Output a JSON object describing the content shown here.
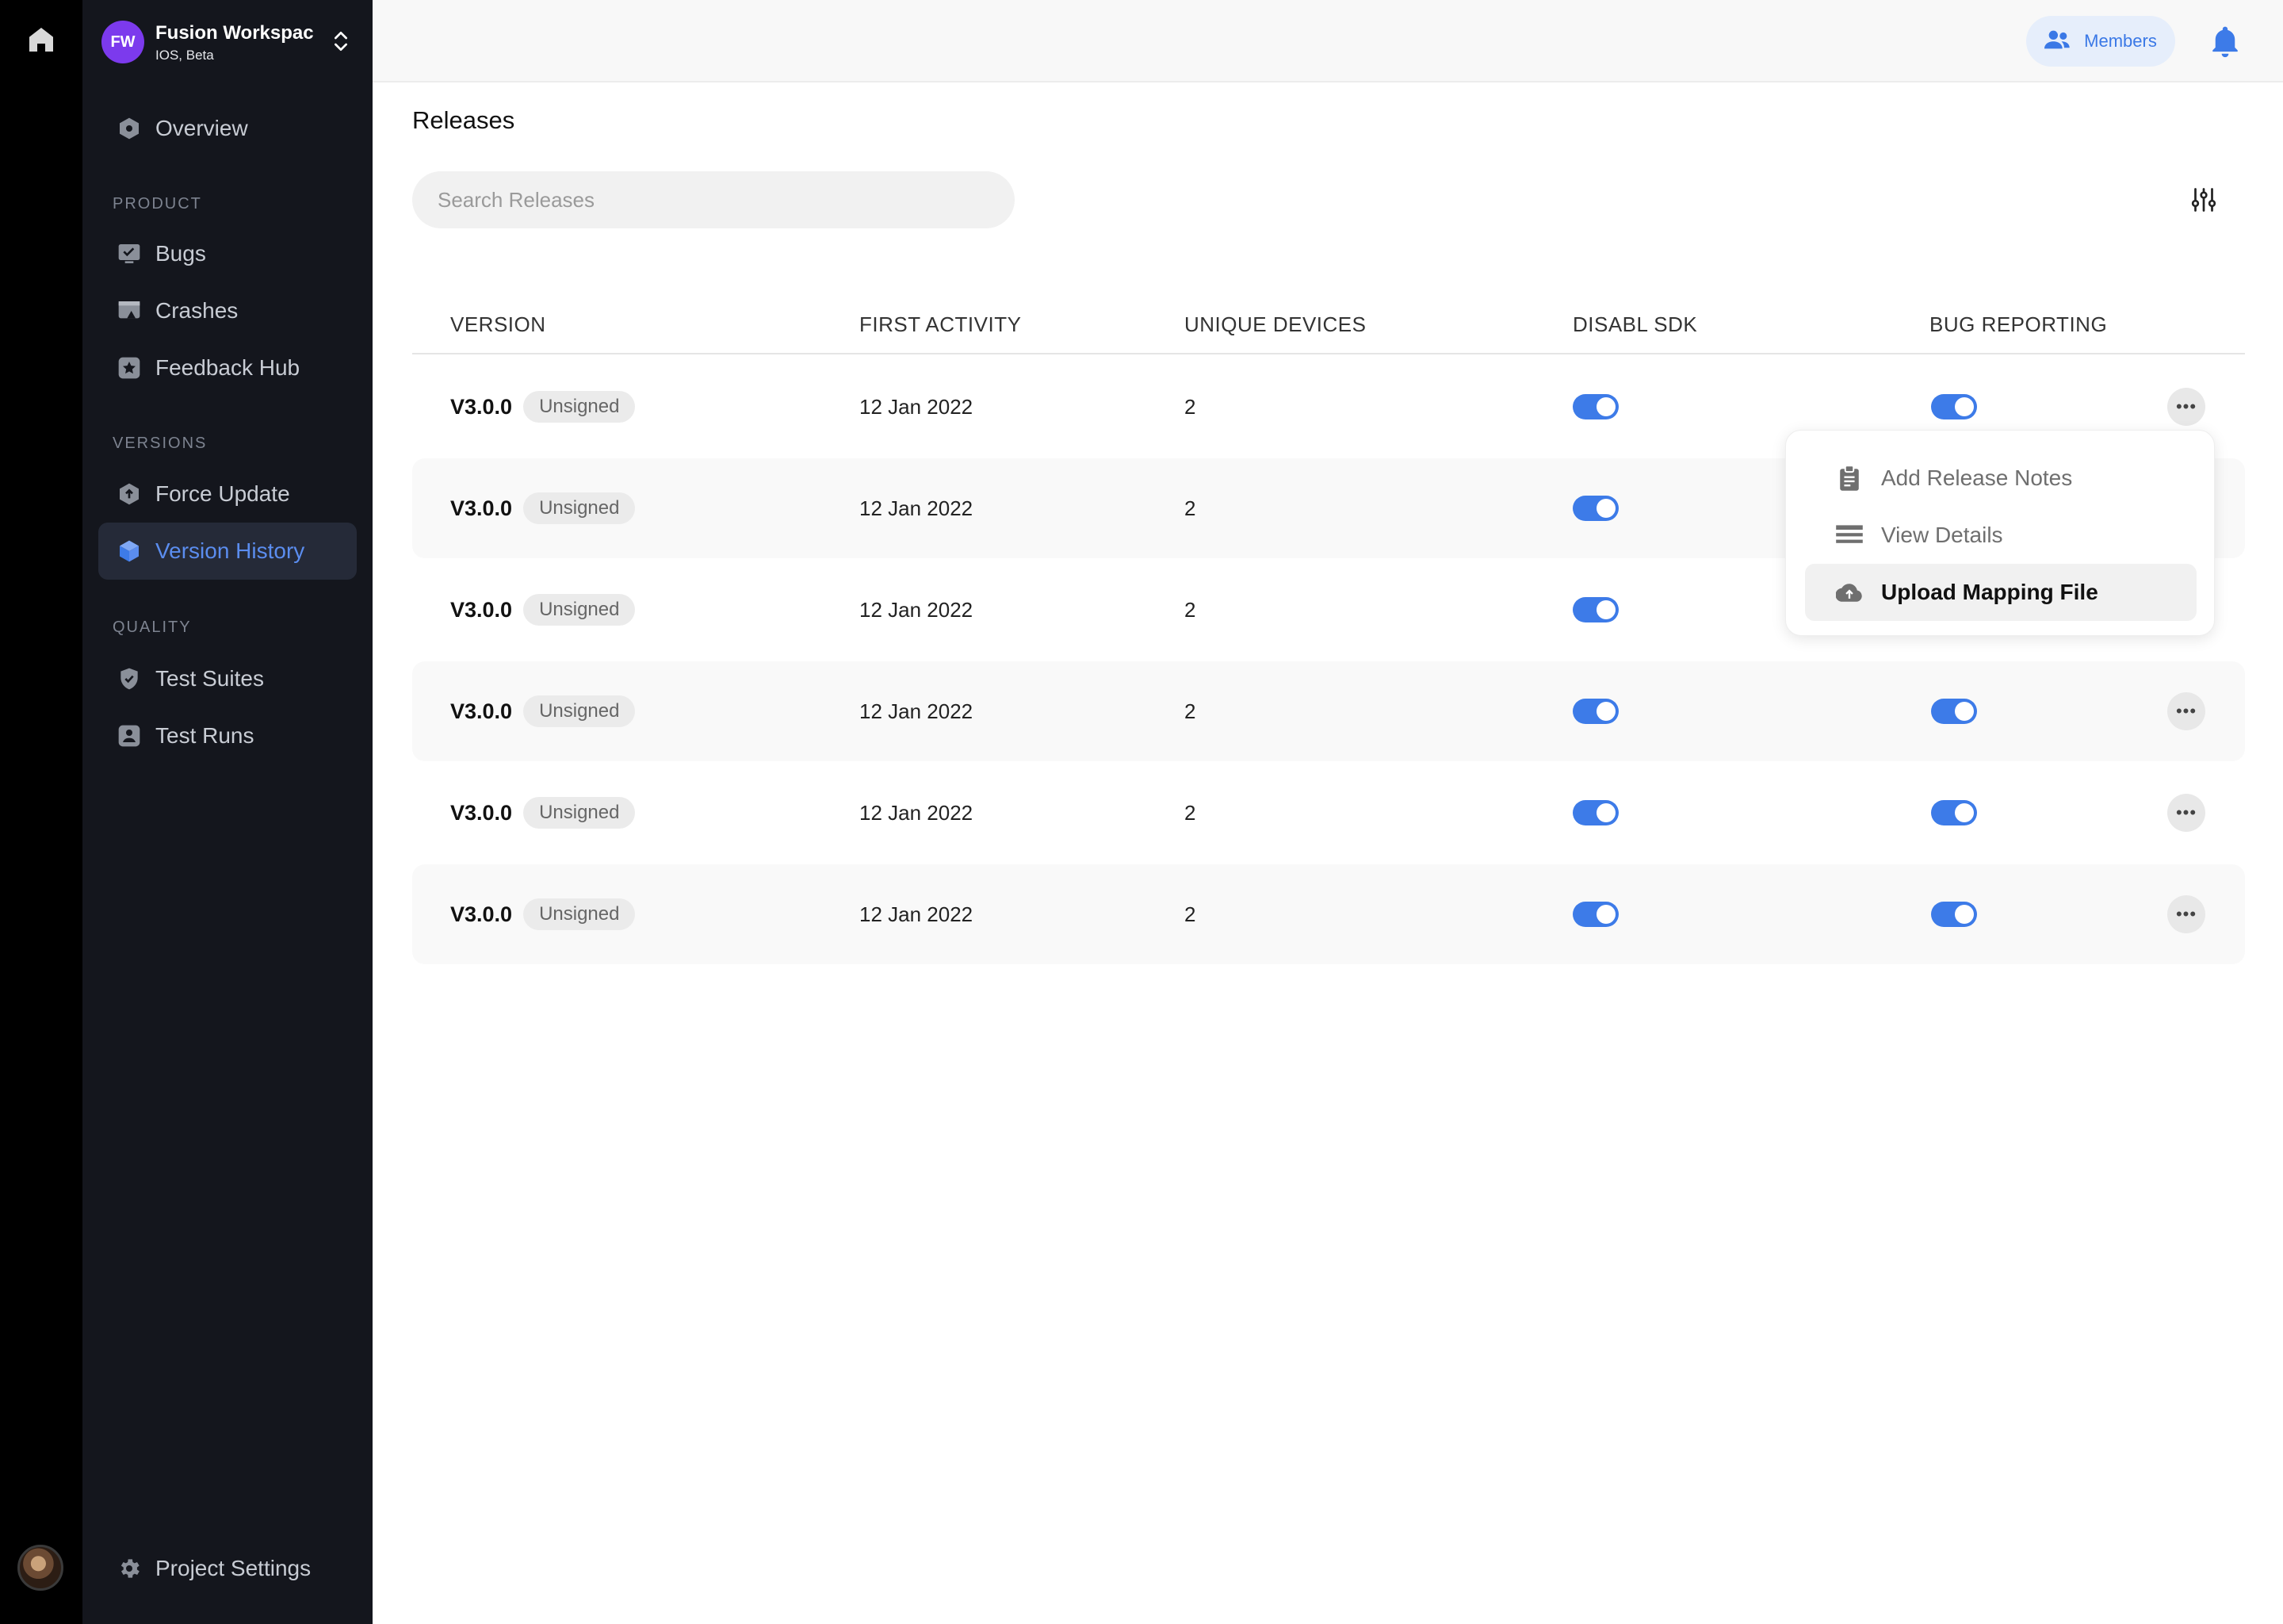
{
  "workspace": {
    "initials": "FW",
    "name": "Fusion Workspace",
    "subtitle": "IOS, Beta"
  },
  "sidebar": {
    "overview": "Overview",
    "sections": [
      {
        "label": "PRODUCT",
        "items": [
          "Bugs",
          "Crashes",
          "Feedback Hub"
        ]
      },
      {
        "label": "VERSIONS",
        "items": [
          "Force Update",
          "Version History"
        ]
      },
      {
        "label": "QUALITY",
        "items": [
          "Test Suites",
          "Test Runs"
        ]
      }
    ],
    "active_item": "Version History",
    "footer_item": "Project Settings"
  },
  "topbar": {
    "members_label": "Members"
  },
  "main": {
    "title": "Releases",
    "search_placeholder": "Search Releases",
    "columns": [
      "VERSION",
      "FIRST ACTIVITY",
      "UNIQUE DEVICES",
      "DISABL SDK",
      "BUG REPORTING"
    ],
    "rows": [
      {
        "version": "V3.0.0",
        "status": "Unsigned",
        "first_activity": "12 Jan 2022",
        "unique_devices": "2",
        "disable_sdk": true,
        "bug_reporting": true
      },
      {
        "version": "V3.0.0",
        "status": "Unsigned",
        "first_activity": "12 Jan 2022",
        "unique_devices": "2",
        "disable_sdk": true,
        "bug_reporting": true
      },
      {
        "version": "V3.0.0",
        "status": "Unsigned",
        "first_activity": "12 Jan 2022",
        "unique_devices": "2",
        "disable_sdk": true,
        "bug_reporting": true
      },
      {
        "version": "V3.0.0",
        "status": "Unsigned",
        "first_activity": "12 Jan 2022",
        "unique_devices": "2",
        "disable_sdk": true,
        "bug_reporting": true
      },
      {
        "version": "V3.0.0",
        "status": "Unsigned",
        "first_activity": "12 Jan 2022",
        "unique_devices": "2",
        "disable_sdk": true,
        "bug_reporting": true
      },
      {
        "version": "V3.0.0",
        "status": "Unsigned",
        "first_activity": "12 Jan 2022",
        "unique_devices": "2",
        "disable_sdk": true,
        "bug_reporting": true
      }
    ]
  },
  "row_menu": {
    "items": [
      "Add Release Notes",
      "View Details",
      "Upload Mapping File"
    ],
    "highlighted": "Upload Mapping File"
  },
  "colors": {
    "accent": "#3d7be8",
    "sidebar_bg": "#14161d",
    "rail_bg": "#000000",
    "workspace_badge": "#7c3aed",
    "active_nav_bg": "#252a38"
  }
}
